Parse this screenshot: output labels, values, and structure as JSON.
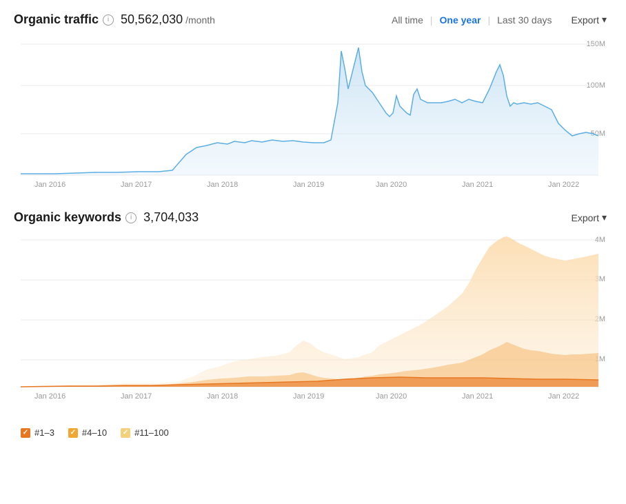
{
  "organic_traffic": {
    "title": "Organic traffic",
    "value": "50,562,030",
    "unit": "/month",
    "info": "i"
  },
  "time_controls": {
    "all_time": "All time",
    "one_year": "One year",
    "last_30_days": "Last 30 days",
    "active": "one_year",
    "export": "Export"
  },
  "organic_keywords": {
    "title": "Organic keywords",
    "value": "3,704,033",
    "info": "i",
    "export": "Export"
  },
  "traffic_chart": {
    "x_labels": [
      "Jan 2016",
      "Jan 2017",
      "Jan 2018",
      "Jan 2019",
      "Jan 2020",
      "Jan 2021",
      "Jan 2022"
    ],
    "y_labels": [
      "150M",
      "100M",
      "50M"
    ],
    "color": "#5baee3",
    "fill": "#d6eaf8"
  },
  "keywords_chart": {
    "x_labels": [
      "Jan 2016",
      "Jan 2017",
      "Jan 2018",
      "Jan 2019",
      "Jan 2020",
      "Jan 2021",
      "Jan 2022"
    ],
    "y_labels": [
      "4M",
      "3M",
      "2M",
      "1M"
    ],
    "legend": [
      {
        "label": "#1–3",
        "color": "#e87722",
        "checked": true
      },
      {
        "label": "#4–10",
        "color": "#f0a832",
        "checked": true
      },
      {
        "label": "#11–100",
        "color": "#f5d07a",
        "checked": true
      }
    ]
  }
}
